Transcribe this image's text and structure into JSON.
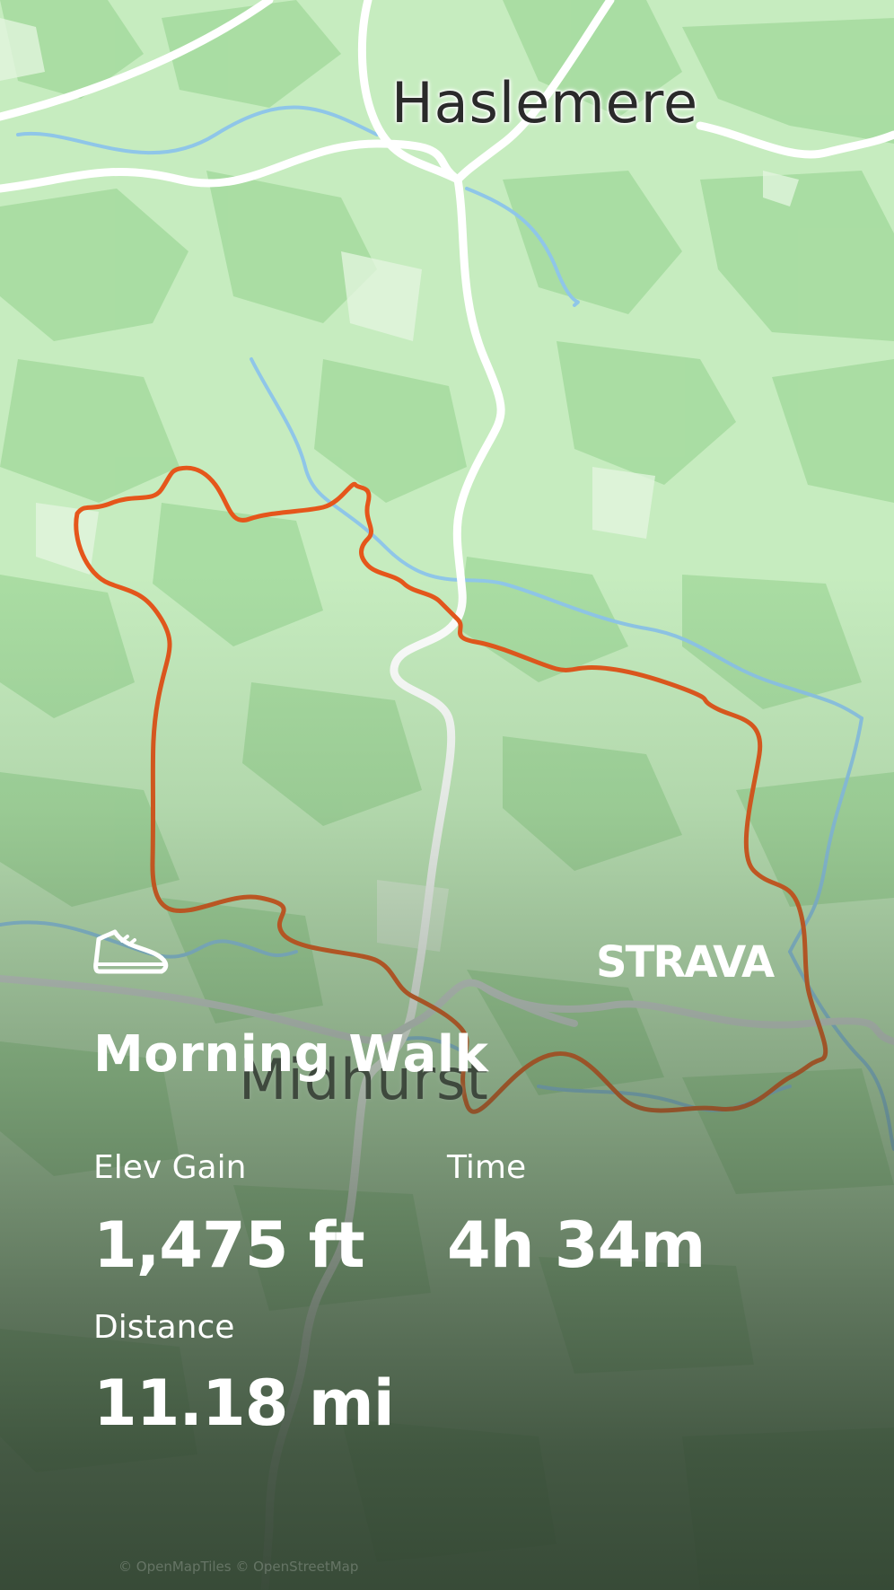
{
  "map": {
    "town_top": "Haslemere",
    "town_bottom": "Midhurst",
    "attribution": "© OpenMapTiles © OpenStreetMap",
    "route_color": "#e5561b",
    "water_color": "#8fc6e8",
    "road_color": "#ffffff"
  },
  "brand": {
    "logo_text": "STRAVA"
  },
  "activity": {
    "type_icon": "shoe-icon",
    "title": "Morning Walk"
  },
  "stats": {
    "elev_gain": {
      "label": "Elev Gain",
      "value": "1,475 ft"
    },
    "time": {
      "label": "Time",
      "value": "4h 34m"
    },
    "distance": {
      "label": "Distance",
      "value": "11.18 mi"
    }
  }
}
